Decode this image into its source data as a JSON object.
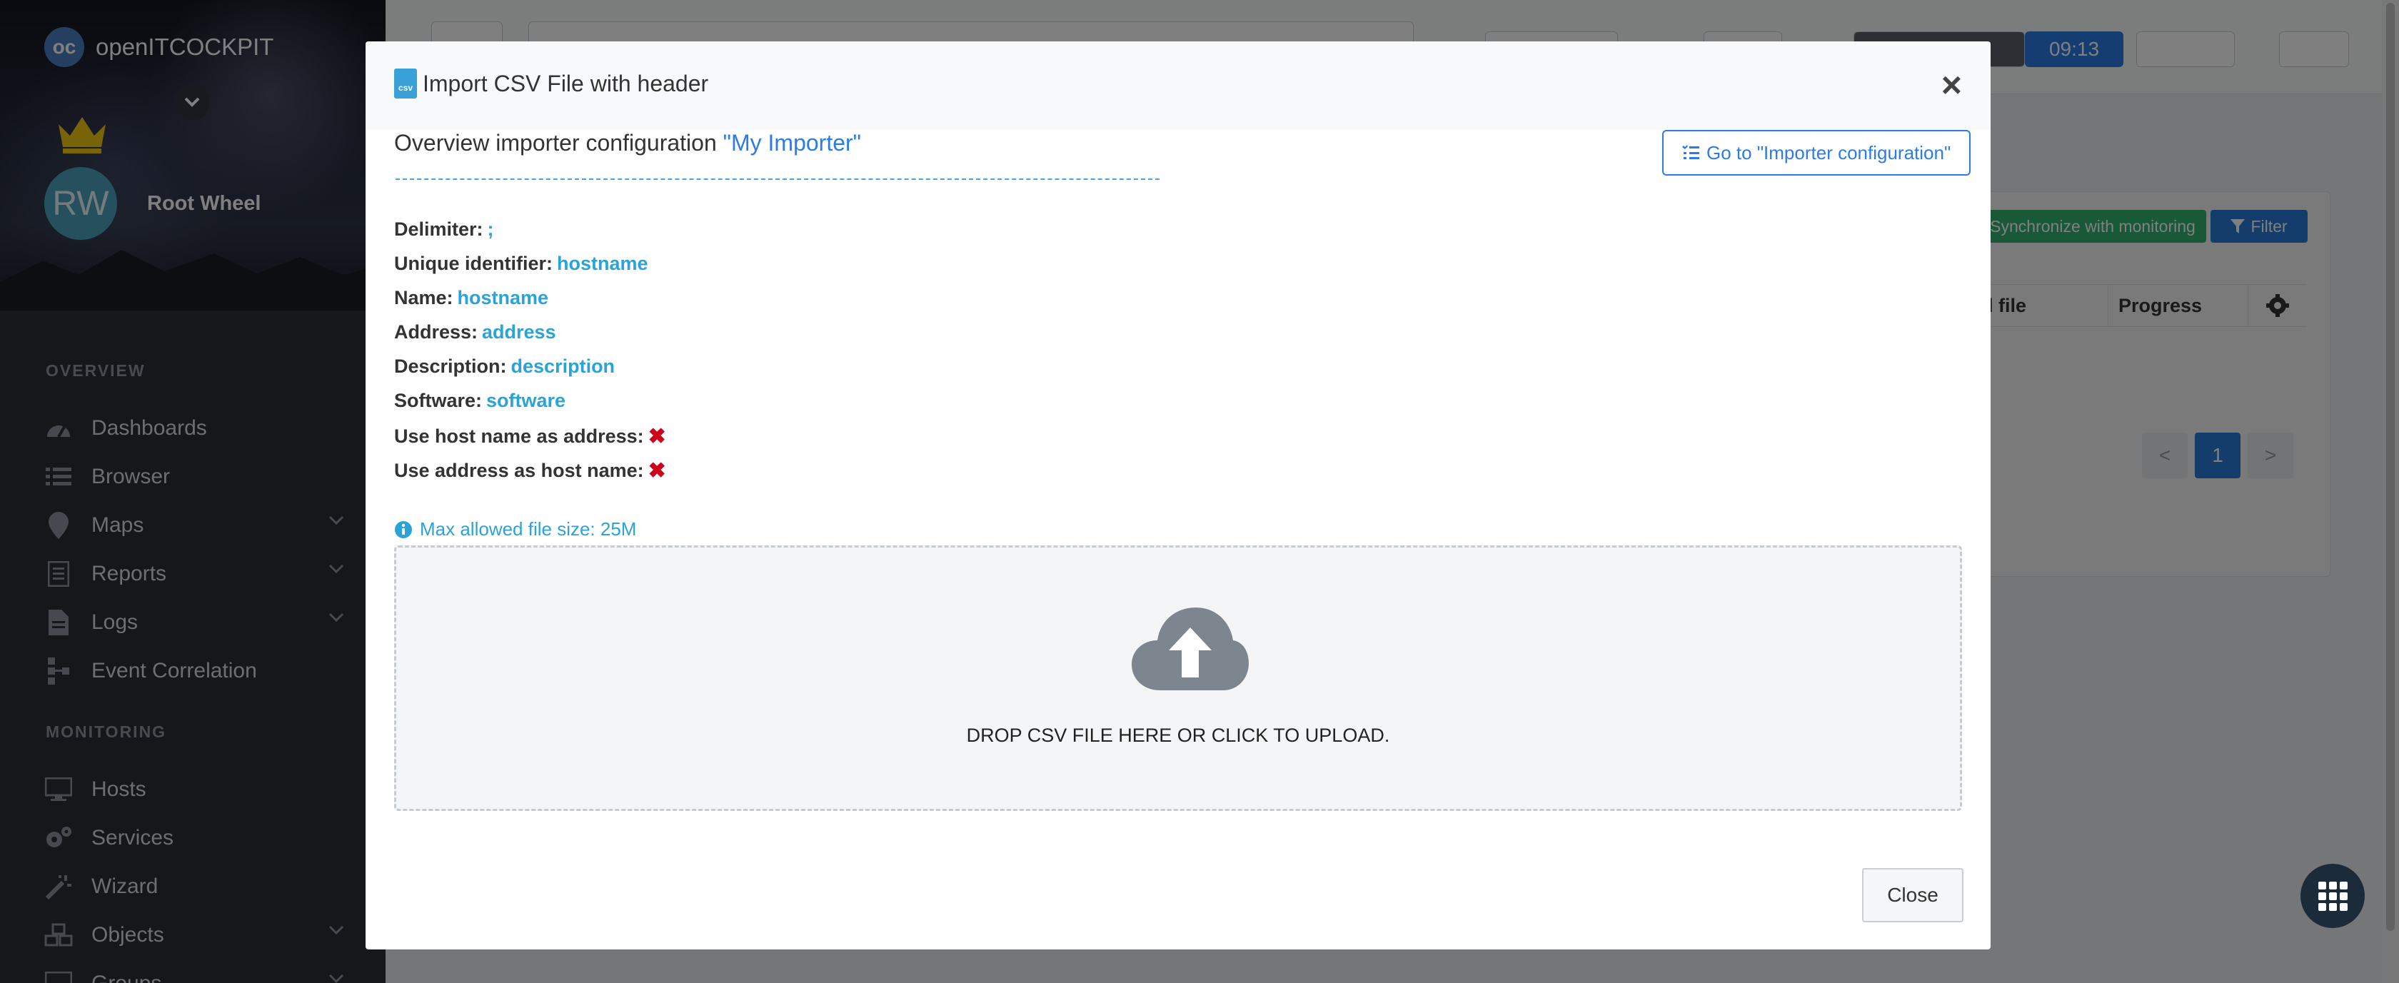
{
  "sidebar": {
    "brand": "openITCOCKPIT",
    "user": {
      "initials": "RW",
      "name": "Root Wheel"
    },
    "sections": [
      "OVERVIEW",
      "MONITORING"
    ],
    "items": [
      {
        "label": "Dashboards",
        "icon": "dashboard-icon"
      },
      {
        "label": "Browser",
        "icon": "list-icon"
      },
      {
        "label": "Maps",
        "icon": "map-pin-icon"
      },
      {
        "label": "Reports",
        "icon": "report-icon"
      },
      {
        "label": "Logs",
        "icon": "file-icon"
      },
      {
        "label": "Event Correlation",
        "icon": "sitemap-icon"
      },
      {
        "label": "Hosts",
        "icon": "desktop-icon"
      },
      {
        "label": "Services",
        "icon": "cogs-icon"
      },
      {
        "label": "Wizard",
        "icon": "magic-icon"
      },
      {
        "label": "Objects",
        "icon": "cubes-icon"
      },
      {
        "label": "Groups",
        "icon": "object-group-icon"
      }
    ]
  },
  "topbar": {
    "clock": "09:13"
  },
  "background_page": {
    "sync_label": "Synchronize with monitoring",
    "filter_label": "Filter",
    "columns": [
      "ed file",
      "Progress"
    ],
    "pager": {
      "prev": "<",
      "current": "1",
      "next": ">"
    }
  },
  "modal": {
    "title": "Import CSV File with header",
    "close_x": "×",
    "csv_badge": "csv",
    "overview_prefix": "Overview importer configuration",
    "overview_name": "\"My Importer\"",
    "goto_label": "Go to \"Importer configuration\"",
    "fields": [
      {
        "label": "Delimiter:",
        "value": ";"
      },
      {
        "label": "Unique identifier:",
        "value": "hostname"
      },
      {
        "label": "Name:",
        "value": "hostname"
      },
      {
        "label": "Address:",
        "value": "address"
      },
      {
        "label": "Description:",
        "value": "description"
      },
      {
        "label": "Software:",
        "value": "software"
      },
      {
        "label": "Use host name as address:",
        "value": "✖"
      },
      {
        "label": "Use address as host name:",
        "value": "✖"
      }
    ],
    "max_size": "Max allowed file size: 25M",
    "dropzone_text": "DROP CSV FILE HERE OR CLICK TO UPLOAD.",
    "close_button": "Close"
  },
  "colors": {
    "accent": "#2d7be5",
    "value_blue": "#2ba3d6",
    "danger": "#d0021b",
    "sidebar_bg": "#2a2f36"
  }
}
